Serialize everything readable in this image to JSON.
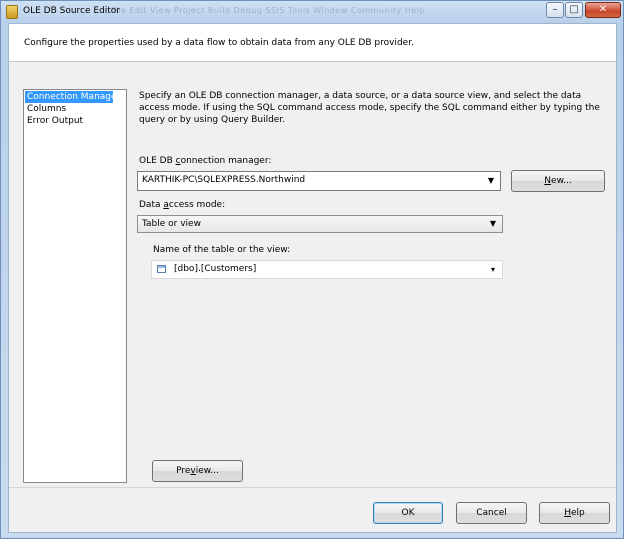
{
  "window": {
    "title": "OLE DB Source Editor",
    "ghost_menu": "File   Edit   View   Project   Build   Debug   SSIS   Tools   Window   Community   Help",
    "minimize_glyph": "–",
    "maximize_glyph": "□",
    "close_glyph": "✕"
  },
  "header": {
    "text": "Configure the properties used by a data flow to obtain data from any OLE DB provider."
  },
  "nav": {
    "items": [
      {
        "label": "Connection Manager",
        "selected": true
      },
      {
        "label": "Columns",
        "selected": false
      },
      {
        "label": "Error Output",
        "selected": false
      }
    ]
  },
  "main": {
    "description": "Specify an OLE DB connection manager, a data source, or a data source view, and select the data access mode. If using the SQL command access mode, specify the SQL command either by typing the query or by using Query Builder.",
    "conn_label_a": "OLE DB ",
    "conn_label_key": "c",
    "conn_label_b": "onnection manager:",
    "conn_value": "KARTHIK-PC\\SQLEXPRESS.Northwind",
    "new_button_key": "N",
    "new_button_rest": "ew...",
    "access_label_a": "Data ",
    "access_label_key": "a",
    "access_label_b": "ccess mode:",
    "access_value": "Table or view",
    "table_label": "Name of the table or the view:",
    "table_value": "[dbo].[Customers]",
    "preview_button_a": "Pre",
    "preview_button_key": "v",
    "preview_button_b": "iew..."
  },
  "footer": {
    "ok_label": "OK",
    "cancel_label": "Cancel",
    "help_key": "H",
    "help_rest": "elp"
  },
  "icons": {
    "app": "ssis-component-icon",
    "table": "table-icon",
    "dropdown": "chevron-down-icon"
  },
  "colors": {
    "selection": "#3399ff",
    "title_gradient_top": "#cfe0f2",
    "close_button": "#c8452b"
  }
}
